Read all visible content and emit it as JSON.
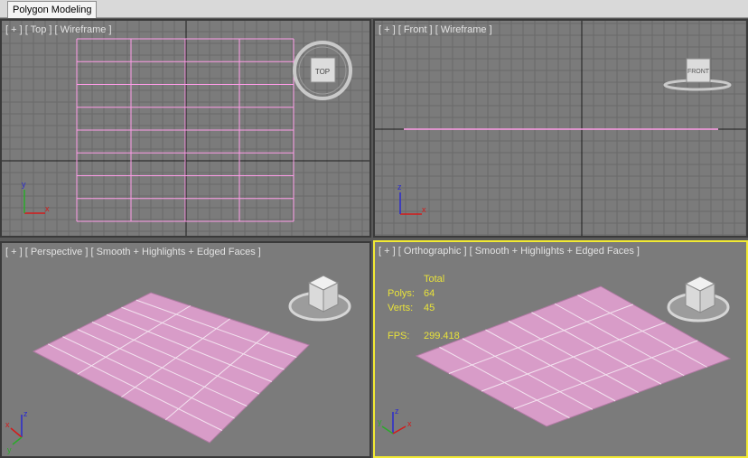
{
  "ribbon": {
    "tab_label": "Polygon Modeling"
  },
  "viewports": {
    "top": {
      "plus": "[ + ]",
      "view": "[ Top ]",
      "shading": "[ Wireframe ]",
      "cube_label": "TOP"
    },
    "front": {
      "plus": "[ + ]",
      "view": "[ Front ]",
      "shading": "[ Wireframe ]",
      "cube_label": "FRONT"
    },
    "perspective": {
      "plus": "[ + ]",
      "view": "[ Perspective ]",
      "shading": "[ Smooth + Highlights + Edged Faces ]"
    },
    "ortho": {
      "plus": "[ + ]",
      "view": "[ Orthographic ]",
      "shading": "[ Smooth + Highlights + Edged Faces ]"
    }
  },
  "stats": {
    "total_label": "Total",
    "polys_label": "Polys:",
    "polys_value": "64",
    "verts_label": "Verts:",
    "verts_value": "45",
    "fps_label": "FPS:",
    "fps_value": "299.418"
  },
  "axes": {
    "x": "x",
    "y": "y",
    "z": "z"
  },
  "colors": {
    "plane": "#d89cc8",
    "wire": "#ff9ce8",
    "active_border": "#f2ea33",
    "grid": "#6a6a6a"
  }
}
